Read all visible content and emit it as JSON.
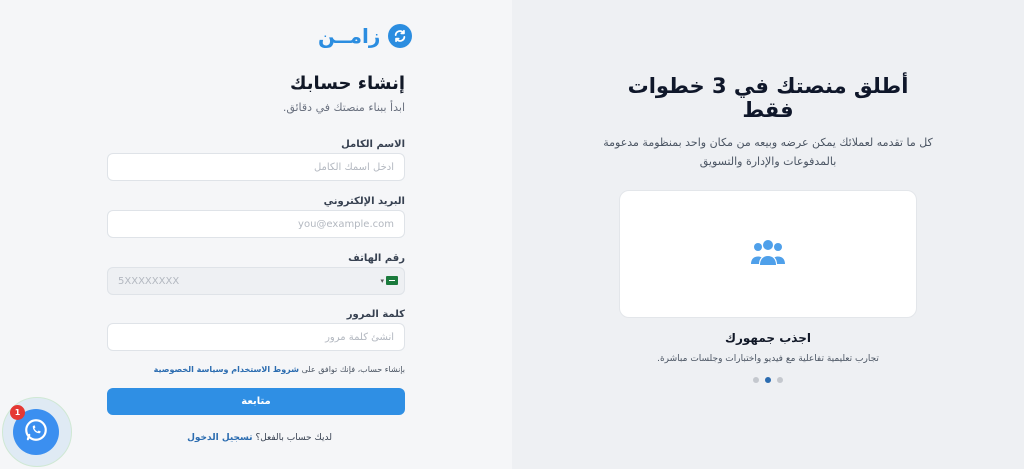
{
  "brand": {
    "name": "زامــن",
    "color": "#2b8de0"
  },
  "form": {
    "title": "إنشاء حسابك",
    "subtitle": "ابدأ ببناء منصتك في دقائق.",
    "fields": {
      "full_name": {
        "label": "الاسم الكامل",
        "placeholder": "أدخل اسمك الكامل",
        "value": ""
      },
      "email": {
        "label": "البريد الإلكتروني",
        "placeholder": "you@example.com",
        "value": ""
      },
      "phone": {
        "label": "رقم الهاتف",
        "placeholder": "5XXXXXXXX",
        "value": "",
        "country_icon": "saudi-flag-icon"
      },
      "password": {
        "label": "كلمة المرور",
        "placeholder": "أنشئ كلمة مرور",
        "value": ""
      }
    },
    "terms_prefix": "بإنشاء حساب، فإنك توافق على",
    "terms_link": "شروط الاستخدام وسياسة الخصوصية",
    "submit_label": "متابعة",
    "login_prompt": "لديك حساب بالفعل؟",
    "login_link": "تسجيل الدخول"
  },
  "whatsapp": {
    "badge_count": "1",
    "icon": "whatsapp-icon",
    "color": "#3b8ff0"
  },
  "hero": {
    "title": "أطلق منصتك في 3 خطوات فقط",
    "subtitle": "كل ما تقدمه لعملائك يمكن عرضه وبيعه من مكان واحد بمنظومة مدعومة بالمدفوعات والإدارة والتسويق",
    "card_icon": "users-group-icon",
    "feature_title": "اجذب جمهورك",
    "feature_desc": "تجارب تعليمية تفاعلية مع فيديو واختبارات وجلسات مباشرة.",
    "slides_total": 3,
    "active_slide": 2,
    "accent": "#2b6cb0"
  }
}
